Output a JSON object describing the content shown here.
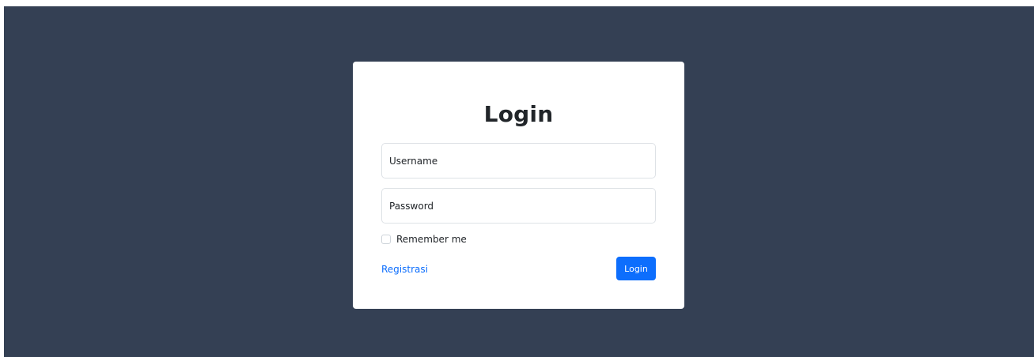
{
  "colors": {
    "background": "#344054",
    "card": "#ffffff",
    "primary": "#0d6efd",
    "text": "#212529"
  },
  "login_card": {
    "title": "Login",
    "username": {
      "placeholder": "Username",
      "value": ""
    },
    "password": {
      "placeholder": "Password",
      "value": ""
    },
    "remember_label": "Remember me",
    "remember_checked": false,
    "register_link": "Registrasi",
    "submit_label": "Login"
  }
}
